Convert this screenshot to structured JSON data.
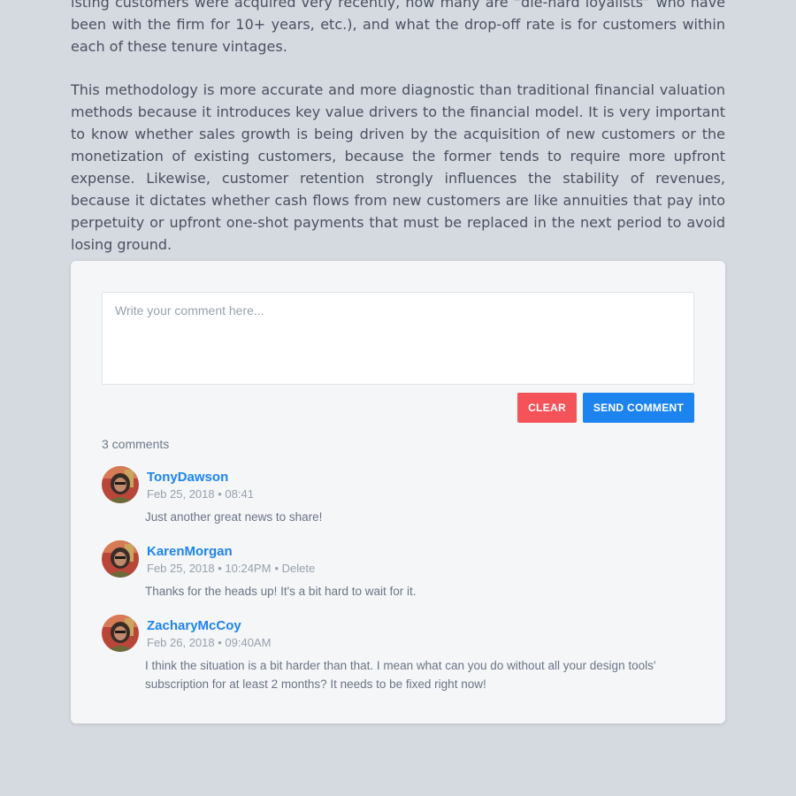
{
  "article": {
    "paragraphs": [
      "isting customers were acquired very recently, how many are “die-hard loyalists” who have been with the firm for 10+ years, etc.), and what the drop-off rate is for customers within each of these tenure vintages.",
      "This methodology is more accurate and more diagnostic than traditional financial valuation methods because it introduces key value drivers to the financial model. It is very important to know whether sales growth is being driven by the acquisition of new customers or the monetization of existing customers, because the former tends to require more upfront expense. Likewise, customer retention strongly influences the stability of revenues, because it dictates whether cash flows from new customers are like annuities that pay into perpetuity or upfront one-shot payments that must be replaced in the next period to avoid losing ground."
    ]
  },
  "comment_form": {
    "placeholder": "Write your comment here...",
    "clear_label": "CLEAR",
    "send_label": "SEND COMMENT"
  },
  "comments_count": "3 comments",
  "comments": [
    {
      "author": "TonyDawson",
      "date": "Feb 25, 2018 • 08:41",
      "delete": "",
      "text": "Just another great news to share!"
    },
    {
      "author": "KarenMorgan",
      "date": "Feb 25, 2018 • 10:24PM",
      "delete": "• Delete",
      "text": "Thanks for the heads up! It's a bit hard to wait for it."
    },
    {
      "author": "ZacharyMcCoy",
      "date": "Feb 26, 2018 • 09:40AM",
      "delete": "",
      "text": "I think the situation is a bit harder than that. I mean what can you do without all your design tools' subscription for at least  2 months? It needs to be fixed right now!"
    }
  ],
  "colors": {
    "page_background": "#d5d9e0",
    "card_background": "#f4f6f8",
    "accent_blue": "#1d84ef",
    "clear_red": "#f5535a"
  }
}
